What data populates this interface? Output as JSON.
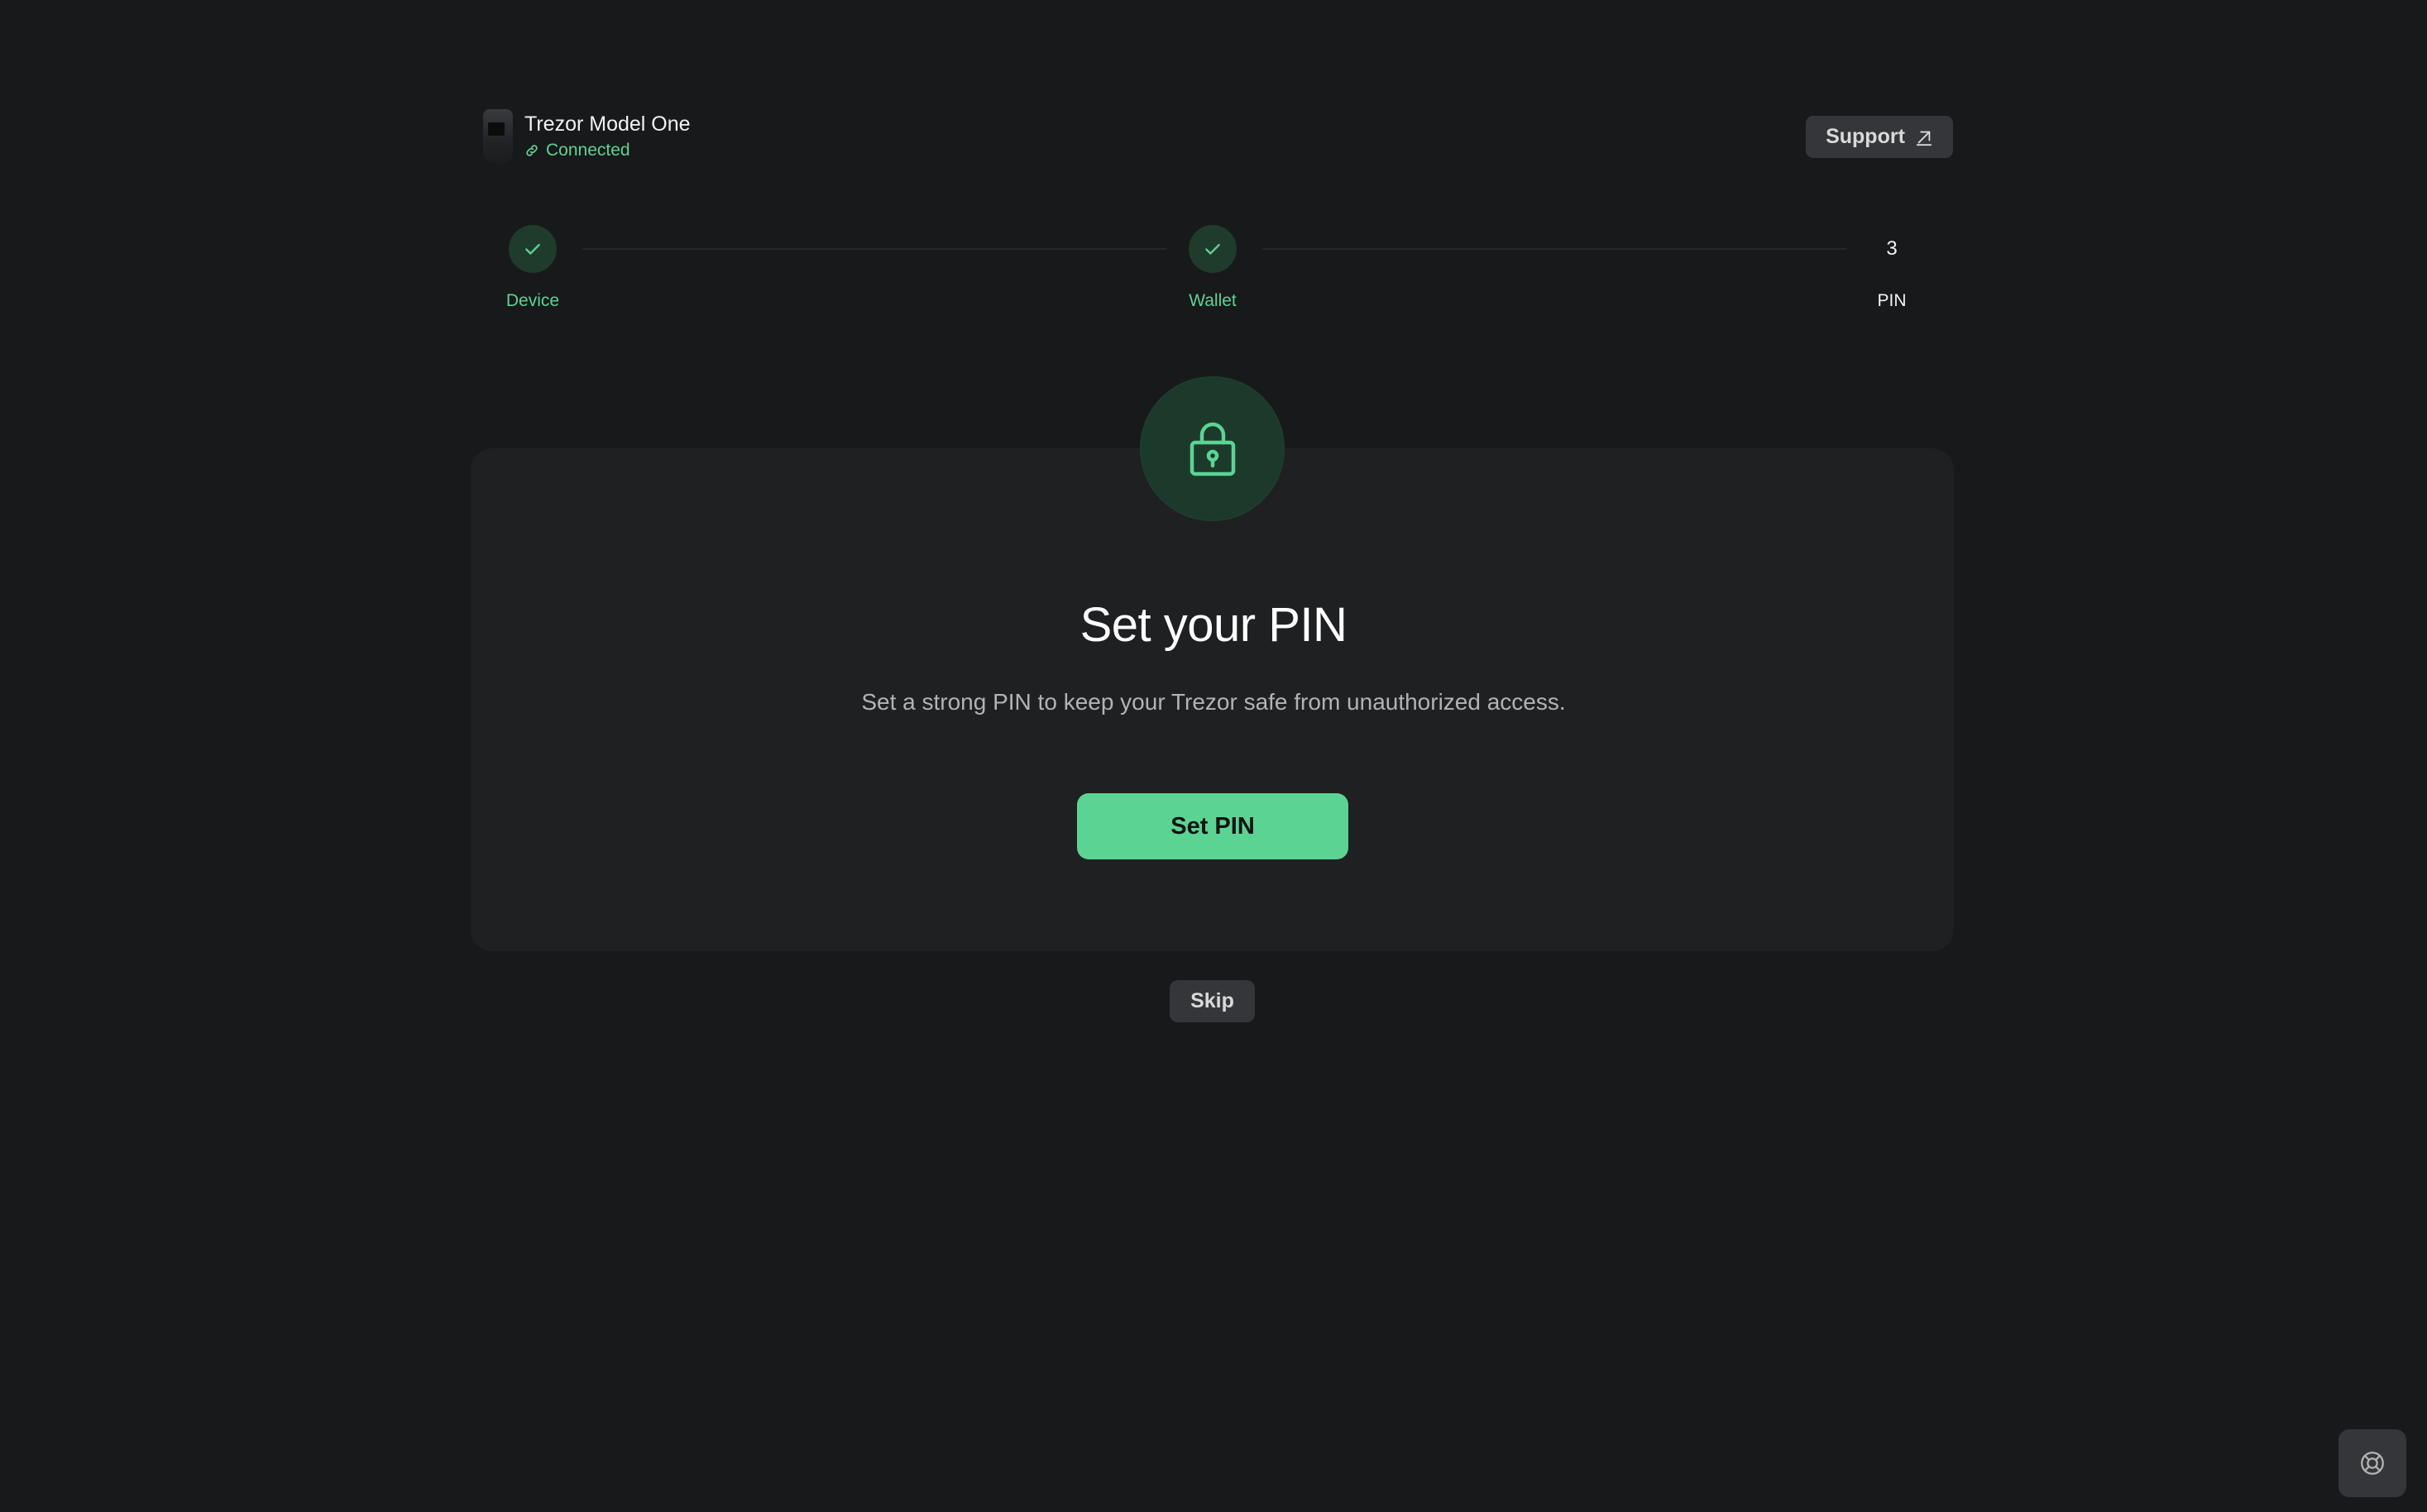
{
  "device": {
    "name": "Trezor Model One",
    "status": "Connected",
    "status_icon": "link-icon"
  },
  "support": {
    "label": "Support",
    "icon": "external-arrow-icon"
  },
  "stepper": {
    "steps": [
      {
        "label": "Device",
        "state": "done"
      },
      {
        "label": "Wallet",
        "state": "done"
      },
      {
        "number": "3",
        "label": "PIN",
        "state": "current"
      }
    ]
  },
  "card": {
    "icon": "lock-icon",
    "title": "Set your PIN",
    "description": "Set a strong PIN to keep your Trezor safe from unauthorized access.",
    "primary_label": "Set PIN"
  },
  "skip": {
    "label": "Skip"
  },
  "help": {
    "icon": "lifebuoy-icon"
  },
  "colors": {
    "background": "#18191b",
    "card": "#1f2022",
    "accent": "#5bd493",
    "accent_dark": "#1f3b2c",
    "button_secondary": "#35363a"
  }
}
